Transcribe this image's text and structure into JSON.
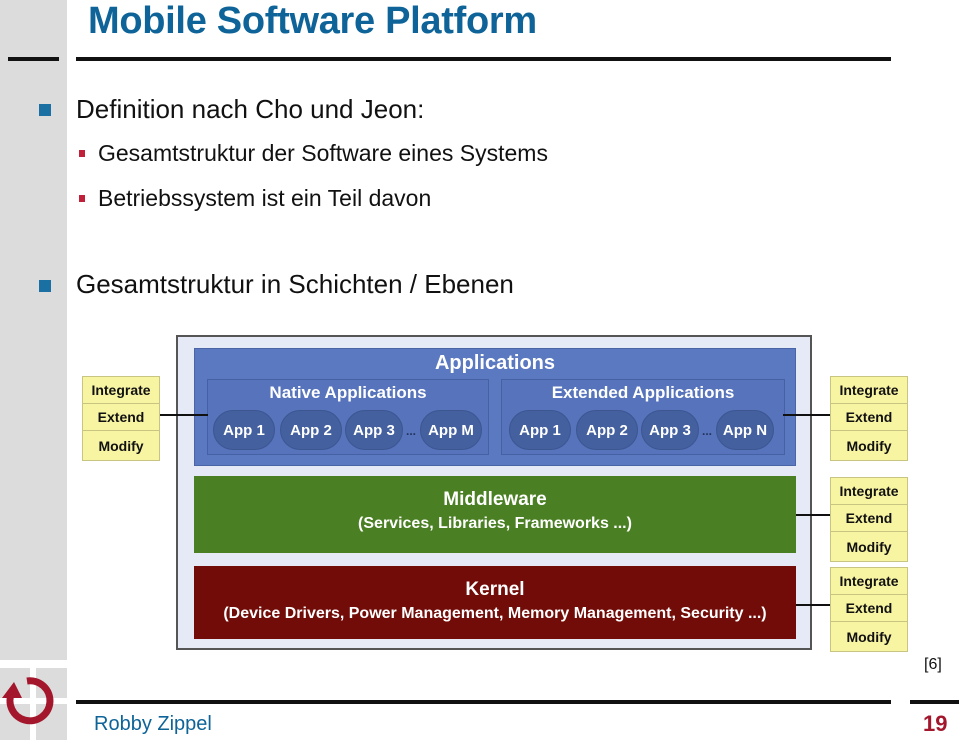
{
  "slide": {
    "title": "Mobile Software Platform",
    "bullets": [
      {
        "text": "Definition nach Cho und Jeon:",
        "sub": [
          "Gesamtstruktur der Software eines Systems",
          "Betriebssystem ist ein Teil davon"
        ]
      },
      {
        "text": "Gesamtstruktur in Schichten / Ebenen",
        "sub": []
      }
    ],
    "reference": "[6]",
    "author": "Robby Zippel",
    "page_number": "19"
  },
  "diagram": {
    "applications": {
      "title": "Applications",
      "native": {
        "title": "Native Applications",
        "apps": [
          "App 1",
          "App 2",
          "App 3",
          "App M"
        ],
        "ellipsis": "..."
      },
      "extended": {
        "title": "Extended Applications",
        "apps": [
          "App 1",
          "App 2",
          "App 3",
          "App N"
        ],
        "ellipsis": "..."
      }
    },
    "middleware": {
      "title": "Middleware",
      "subtitle": "(Services, Libraries, Frameworks ...)"
    },
    "kernel": {
      "title": "Kernel",
      "subtitle": "(Device Drivers, Power Management, Memory Management, Security ...)"
    },
    "operations": [
      "Integrate",
      "Extend",
      "Modify"
    ]
  },
  "colors": {
    "title": "#0e6498",
    "applications": "#5b79c0",
    "middleware": "#4a7f23",
    "kernel": "#720c08",
    "operations": "#f8f5a2",
    "accent_red": "#a3162c"
  }
}
